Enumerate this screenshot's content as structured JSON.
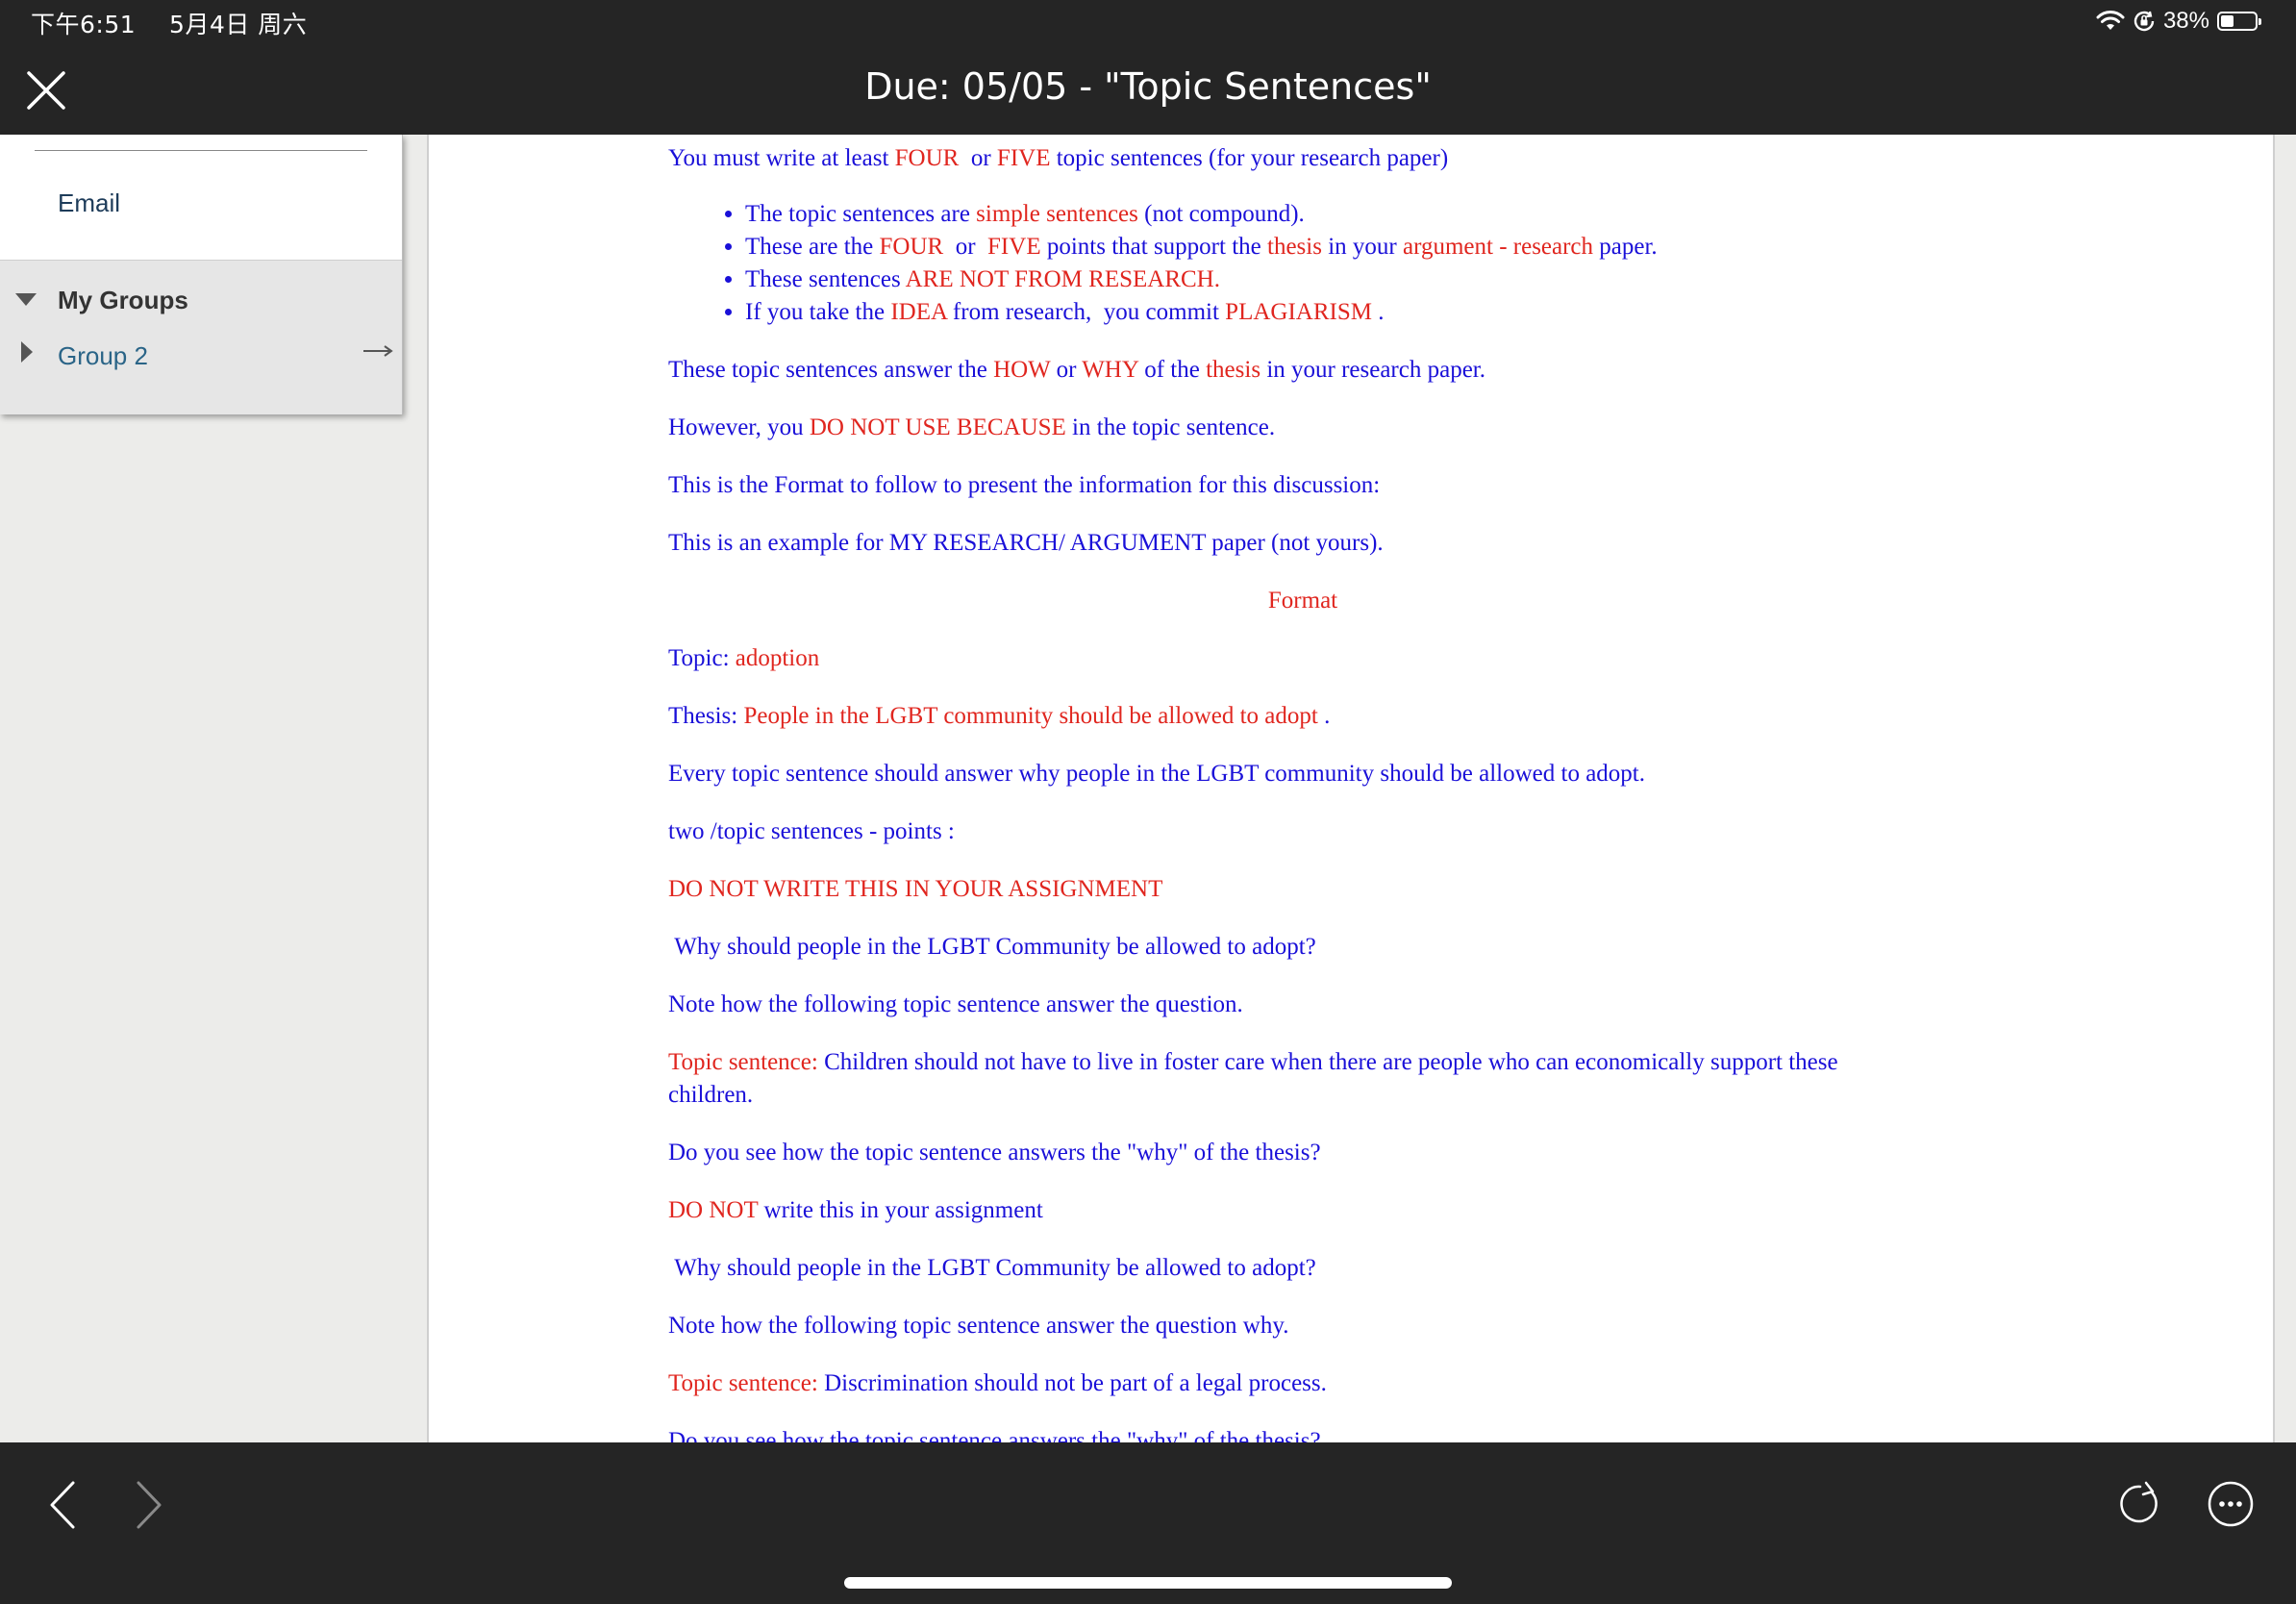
{
  "status_bar": {
    "time": "下午6:51",
    "date": "5月4日 周六",
    "battery_percent": "38%",
    "battery_level": 0.38,
    "icons": [
      "wifi-icon",
      "orientation-lock-icon",
      "battery-icon"
    ]
  },
  "header": {
    "title": "Due: 05/05 - \"Topic Sentences\"",
    "close_icon": "close-icon"
  },
  "sidebar": {
    "email_label": "Email",
    "groups_heading": "My Groups",
    "group_item": "Group 2",
    "group_arrow_icon": "arrow-right-icon"
  },
  "document": {
    "intro": [
      {
        "t": "You must write at least ",
        "c": "b"
      },
      {
        "t": "FOUR",
        "c": "r"
      },
      {
        "t": "  or ",
        "c": "b"
      },
      {
        "t": "FIVE",
        "c": "r"
      },
      {
        "t": " topic sentences (for your research paper)",
        "c": "b"
      }
    ],
    "bullets": [
      [
        {
          "t": "The topic sentences are ",
          "c": "b"
        },
        {
          "t": "simple sentences",
          "c": "r"
        },
        {
          "t": " (not compound).",
          "c": "b"
        }
      ],
      [
        {
          "t": "These are the ",
          "c": "b"
        },
        {
          "t": "FOUR",
          "c": "r"
        },
        {
          "t": "  or  ",
          "c": "b"
        },
        {
          "t": "FIVE",
          "c": "r"
        },
        {
          "t": " points that support the ",
          "c": "b"
        },
        {
          "t": "thesis",
          "c": "r"
        },
        {
          "t": " in your ",
          "c": "b"
        },
        {
          "t": "argument - research",
          "c": "r"
        },
        {
          "t": " paper.",
          "c": "b"
        }
      ],
      [
        {
          "t": "These sentences ",
          "c": "b"
        },
        {
          "t": "ARE NOT FROM RESEARCH.",
          "c": "r"
        }
      ],
      [
        {
          "t": "If you take the ",
          "c": "b"
        },
        {
          "t": "IDEA",
          "c": "r"
        },
        {
          "t": " from research,  you commit ",
          "c": "b"
        },
        {
          "t": "PLAGIARISM",
          "c": "r"
        },
        {
          "t": " .",
          "c": "b"
        }
      ]
    ],
    "para_how_why": [
      {
        "t": "These topic sentences answer the ",
        "c": "b"
      },
      {
        "t": "HOW",
        "c": "r"
      },
      {
        "t": " or ",
        "c": "b"
      },
      {
        "t": "WHY",
        "c": "r"
      },
      {
        "t": " of the ",
        "c": "b"
      },
      {
        "t": "thesis",
        "c": "r"
      },
      {
        "t": " in your research paper.",
        "c": "b"
      }
    ],
    "para_because": [
      {
        "t": "However, you ",
        "c": "b"
      },
      {
        "t": "DO NOT USE BECAUSE",
        "c": "r"
      },
      {
        "t": " in the topic sentence.",
        "c": "b"
      }
    ],
    "para_format": [
      {
        "t": "This is the Format to follow to present the information for this discussion:",
        "c": "b"
      }
    ],
    "para_example": [
      {
        "t": "This is an example for MY RESEARCH/ ARGUMENT paper (not yours).",
        "c": "b"
      }
    ],
    "format_heading": [
      {
        "t": "Format",
        "c": "r"
      }
    ],
    "topic": [
      {
        "t": "Topic: ",
        "c": "b"
      },
      {
        "t": "adoption",
        "c": "r"
      }
    ],
    "thesis": [
      {
        "t": "Thesis: ",
        "c": "b"
      },
      {
        "t": "People in the LGBT community should be allowed to adopt",
        "c": "r"
      },
      {
        "t": " .",
        "c": "b"
      }
    ],
    "every_topic": [
      {
        "t": "Every topic sentence should answer why people in the LGBT community should be allowed to adopt.",
        "c": "b"
      }
    ],
    "two_topic": [
      {
        "t": "two /topic sentences - points :",
        "c": "b"
      }
    ],
    "do_not_write_1": [
      {
        "t": "DO NOT WRITE THIS IN YOUR ASSIGNMENT",
        "c": "r"
      }
    ],
    "question_1": [
      {
        "t": " Why should people in the LGBT Community be allowed to adopt?",
        "c": "b"
      }
    ],
    "note_1": [
      {
        "t": "Note how the following topic sentence answer the question.",
        "c": "b"
      }
    ],
    "topic_sentence_1": [
      {
        "t": "Topic sentence: ",
        "c": "r"
      },
      {
        "t": "Children should not have to live in foster care when there are people who can economically support these children.",
        "c": "b"
      }
    ],
    "see_how_1": [
      {
        "t": "Do you see how the topic sentence answers the \"why\" of the thesis?",
        "c": "b"
      }
    ],
    "do_not_write_2": [
      {
        "t": "DO NOT",
        "c": "r"
      },
      {
        "t": " write this in your assignment",
        "c": "b"
      }
    ],
    "question_2": [
      {
        "t": " Why should people in the LGBT Community be allowed to adopt?",
        "c": "b"
      }
    ],
    "note_2": [
      {
        "t": "Note how the following topic sentence answer the question why.",
        "c": "b"
      }
    ],
    "topic_sentence_2": [
      {
        "t": "Topic sentence: ",
        "c": "r"
      },
      {
        "t": "Discrimination should not be part of a legal process.",
        "c": "b"
      }
    ],
    "see_how_2": [
      {
        "t": "Do you see how the topic sentence answers the \"why\" of the thesis?",
        "c": "b"
      }
    ]
  },
  "toolbar": {
    "icons": [
      "back-icon",
      "forward-icon",
      "reload-icon",
      "more-icon"
    ]
  },
  "colors": {
    "text_blue": "#1a10d8",
    "text_red": "#e0261f",
    "chrome_dark": "#252525"
  }
}
